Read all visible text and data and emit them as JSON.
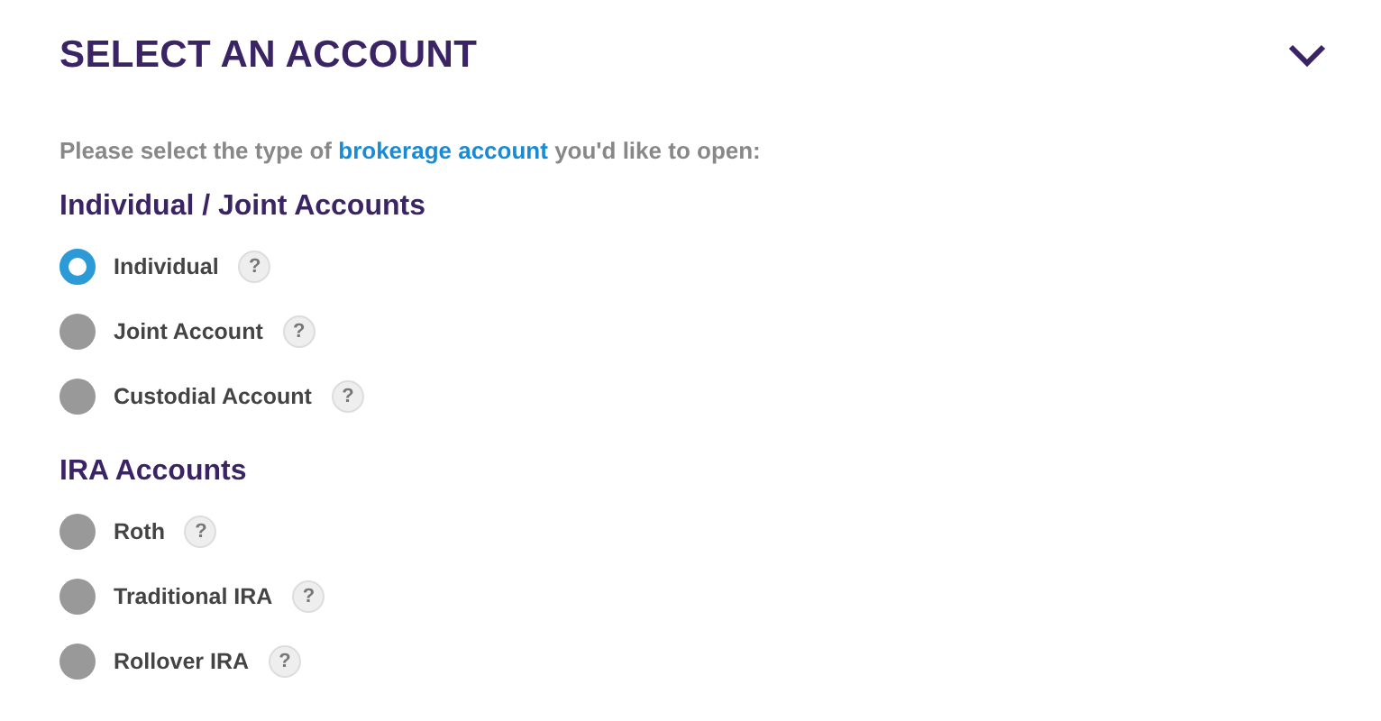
{
  "header": {
    "title": "SELECT AN ACCOUNT",
    "expanded": true
  },
  "intro": {
    "before": "Please select the type of ",
    "link": "brokerage account",
    "after": " you'd like to open:"
  },
  "groups": [
    {
      "heading": "Individual / Joint Accounts",
      "options": [
        {
          "label": "Individual",
          "help": "?",
          "selected": true
        },
        {
          "label": "Joint Account",
          "help": "?",
          "selected": false
        },
        {
          "label": "Custodial Account",
          "help": "?",
          "selected": false
        }
      ]
    },
    {
      "heading": "IRA Accounts",
      "options": [
        {
          "label": "Roth",
          "help": "?",
          "selected": false
        },
        {
          "label": "Traditional IRA",
          "help": "?",
          "selected": false
        },
        {
          "label": "Rollover IRA",
          "help": "?",
          "selected": false
        }
      ]
    }
  ]
}
